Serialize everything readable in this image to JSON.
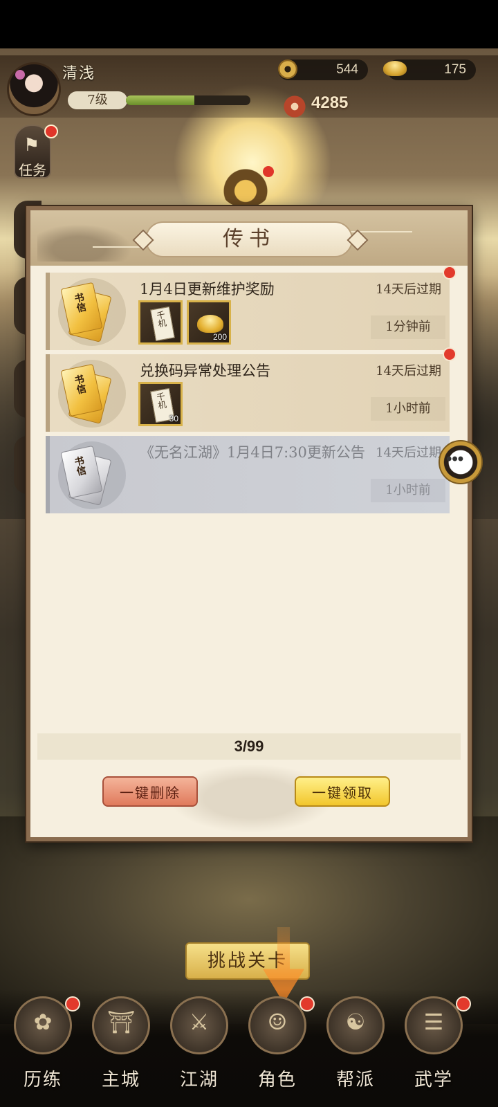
{
  "player": {
    "name": "清浅",
    "level": "7级",
    "exp_fraction": 0.55,
    "coins": "544",
    "ingots": "175",
    "power": "4285"
  },
  "side": {
    "task_label": "任务"
  },
  "panel": {
    "title": "传书",
    "mails": [
      {
        "title": "1月4日更新维护奖励",
        "expire": "14天后过期",
        "time": "1分钟前",
        "letter_text": "书信",
        "unread": true,
        "items": [
          {
            "icon": "scroll-item-icon",
            "label": "千机",
            "count": ""
          },
          {
            "icon": "gold-ingot-icon",
            "label": "",
            "count": "200"
          }
        ]
      },
      {
        "title": "兑换码异常处理公告",
        "expire": "14天后过期",
        "time": "1小时前",
        "letter_text": "书信",
        "unread": true,
        "items": [
          {
            "icon": "scroll-item-icon",
            "label": "千机",
            "count": "30"
          }
        ]
      },
      {
        "title": "《无名江湖》1月4日7:30更新公告",
        "expire": "14天后过期",
        "time": "1小时前",
        "letter_text": "书信",
        "unread": false,
        "items": []
      }
    ],
    "page_count": "3/99",
    "delete_all_label": "一键删除",
    "claim_all_label": "一键领取"
  },
  "challenge_label": "挑战关卡",
  "nav": {
    "items": [
      {
        "label": "历练",
        "icon": "training-icon",
        "badge": true
      },
      {
        "label": "主城",
        "icon": "city-icon",
        "badge": false
      },
      {
        "label": "江湖",
        "icon": "jianghu-icon",
        "badge": false
      },
      {
        "label": "角色",
        "icon": "character-icon",
        "badge": true
      },
      {
        "label": "帮派",
        "icon": "guild-icon",
        "badge": false
      },
      {
        "label": "武学",
        "icon": "martial-arts-icon",
        "badge": true
      }
    ]
  },
  "colors": {
    "accent_gold": "#f2c62c",
    "badge_red": "#e23a2c",
    "delete_red": "#e07a5c"
  }
}
